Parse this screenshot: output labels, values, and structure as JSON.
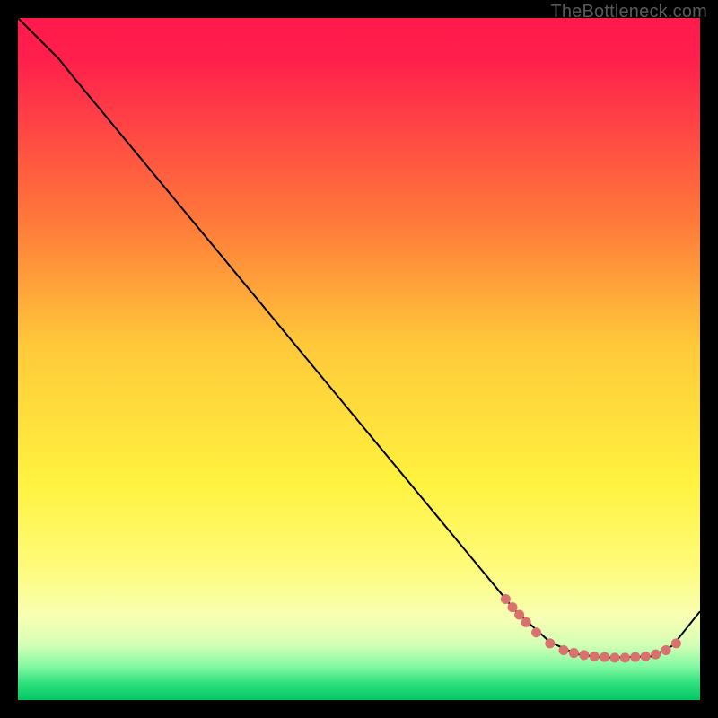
{
  "watermark": "TheBottleneck.com",
  "chart_data": {
    "type": "line",
    "title": "",
    "xlabel": "",
    "ylabel": "",
    "xlim": [
      0,
      100
    ],
    "ylim": [
      0,
      100
    ],
    "grid": false,
    "background": {
      "kind": "vertical-gradient",
      "stops": [
        {
          "pct": 0.0,
          "color": "#ff1a4b"
        },
        {
          "pct": 0.06,
          "color": "#ff1f4c"
        },
        {
          "pct": 0.3,
          "color": "#ff7a3a"
        },
        {
          "pct": 0.48,
          "color": "#ffc93a"
        },
        {
          "pct": 0.68,
          "color": "#fff23f"
        },
        {
          "pct": 0.8,
          "color": "#fffb78"
        },
        {
          "pct": 0.88,
          "color": "#f7ffb4"
        },
        {
          "pct": 0.92,
          "color": "#d2ffb5"
        },
        {
          "pct": 0.95,
          "color": "#86f9a3"
        },
        {
          "pct": 0.975,
          "color": "#30e07c"
        },
        {
          "pct": 1.0,
          "color": "#00c864"
        }
      ]
    },
    "curve": {
      "name": "bottleneck-curve",
      "color": "#000000",
      "points_xy": [
        [
          0,
          100
        ],
        [
          6,
          94
        ],
        [
          8,
          91.5
        ],
        [
          73,
          13
        ],
        [
          78,
          8.5
        ],
        [
          82,
          6.7
        ],
        [
          86,
          6.2
        ],
        [
          93,
          6.4
        ],
        [
          96,
          8.0
        ],
        [
          100,
          13
        ]
      ]
    },
    "markers": {
      "name": "highlight-dots",
      "color": "#d9716f",
      "points_xy": [
        [
          71.5,
          14.8
        ],
        [
          72.5,
          13.6
        ],
        [
          73.5,
          12.5
        ],
        [
          74.5,
          11.4
        ],
        [
          76.0,
          9.9
        ],
        [
          78.0,
          8.3
        ],
        [
          80.0,
          7.3
        ],
        [
          81.5,
          6.9
        ],
        [
          83.0,
          6.6
        ],
        [
          84.5,
          6.4
        ],
        [
          86.0,
          6.3
        ],
        [
          87.5,
          6.2
        ],
        [
          89.0,
          6.2
        ],
        [
          90.5,
          6.3
        ],
        [
          92.0,
          6.4
        ],
        [
          93.5,
          6.7
        ],
        [
          95.0,
          7.3
        ],
        [
          96.5,
          8.3
        ]
      ]
    }
  }
}
